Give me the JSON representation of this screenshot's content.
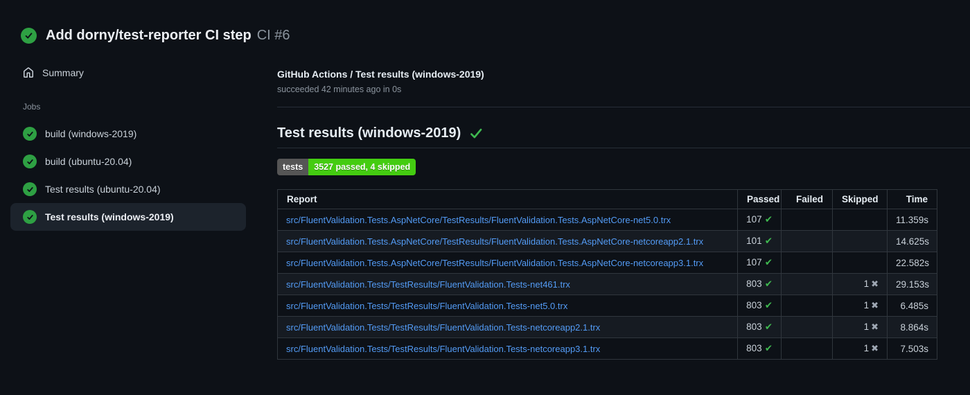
{
  "colors": {
    "page_bg": "#0d1117",
    "accent_green": "#2ea043",
    "check_green": "#3fb950",
    "link_blue": "#539bf5",
    "badge_label_bg": "#555555",
    "badge_value_bg": "#44cc11",
    "table_border": "#30363d"
  },
  "run_header": {
    "title": "Add dorny/test-reporter CI step",
    "run_number": "CI #6",
    "status": "success"
  },
  "sidebar": {
    "summary_label": "Summary",
    "jobs_heading": "Jobs",
    "jobs": [
      {
        "label": "build (windows-2019)",
        "status": "success",
        "selected": false
      },
      {
        "label": "build (ubuntu-20.04)",
        "status": "success",
        "selected": false
      },
      {
        "label": "Test results (ubuntu-20.04)",
        "status": "success",
        "selected": false
      },
      {
        "label": "Test results (windows-2019)",
        "status": "success",
        "selected": true
      }
    ]
  },
  "main": {
    "check_run": {
      "title": "GitHub Actions / Test results (windows-2019)",
      "status_line": "succeeded 42 minutes ago in 0s"
    },
    "section": {
      "title": "Test results (windows-2019)",
      "status": "success"
    },
    "badge": {
      "label": "tests",
      "value": "3527 passed, 4 skipped"
    },
    "table": {
      "headers": [
        "Report",
        "Passed",
        "Failed",
        "Skipped",
        "Time"
      ],
      "rows": [
        {
          "report": "src/FluentValidation.Tests.AspNetCore/TestResults/FluentValidation.Tests.AspNetCore-net5.0.trx",
          "passed": "107",
          "failed": "",
          "skipped": "",
          "time": "11.359s"
        },
        {
          "report": "src/FluentValidation.Tests.AspNetCore/TestResults/FluentValidation.Tests.AspNetCore-netcoreapp2.1.trx",
          "passed": "101",
          "failed": "",
          "skipped": "",
          "time": "14.625s"
        },
        {
          "report": "src/FluentValidation.Tests.AspNetCore/TestResults/FluentValidation.Tests.AspNetCore-netcoreapp3.1.trx",
          "passed": "107",
          "failed": "",
          "skipped": "",
          "time": "22.582s"
        },
        {
          "report": "src/FluentValidation.Tests/TestResults/FluentValidation.Tests-net461.trx",
          "passed": "803",
          "failed": "",
          "skipped": "1",
          "time": "29.153s"
        },
        {
          "report": "src/FluentValidation.Tests/TestResults/FluentValidation.Tests-net5.0.trx",
          "passed": "803",
          "failed": "",
          "skipped": "1",
          "time": "6.485s"
        },
        {
          "report": "src/FluentValidation.Tests/TestResults/FluentValidation.Tests-netcoreapp2.1.trx",
          "passed": "803",
          "failed": "",
          "skipped": "1",
          "time": "8.864s"
        },
        {
          "report": "src/FluentValidation.Tests/TestResults/FluentValidation.Tests-netcoreapp3.1.trx",
          "passed": "803",
          "failed": "",
          "skipped": "1",
          "time": "7.503s"
        }
      ]
    }
  }
}
